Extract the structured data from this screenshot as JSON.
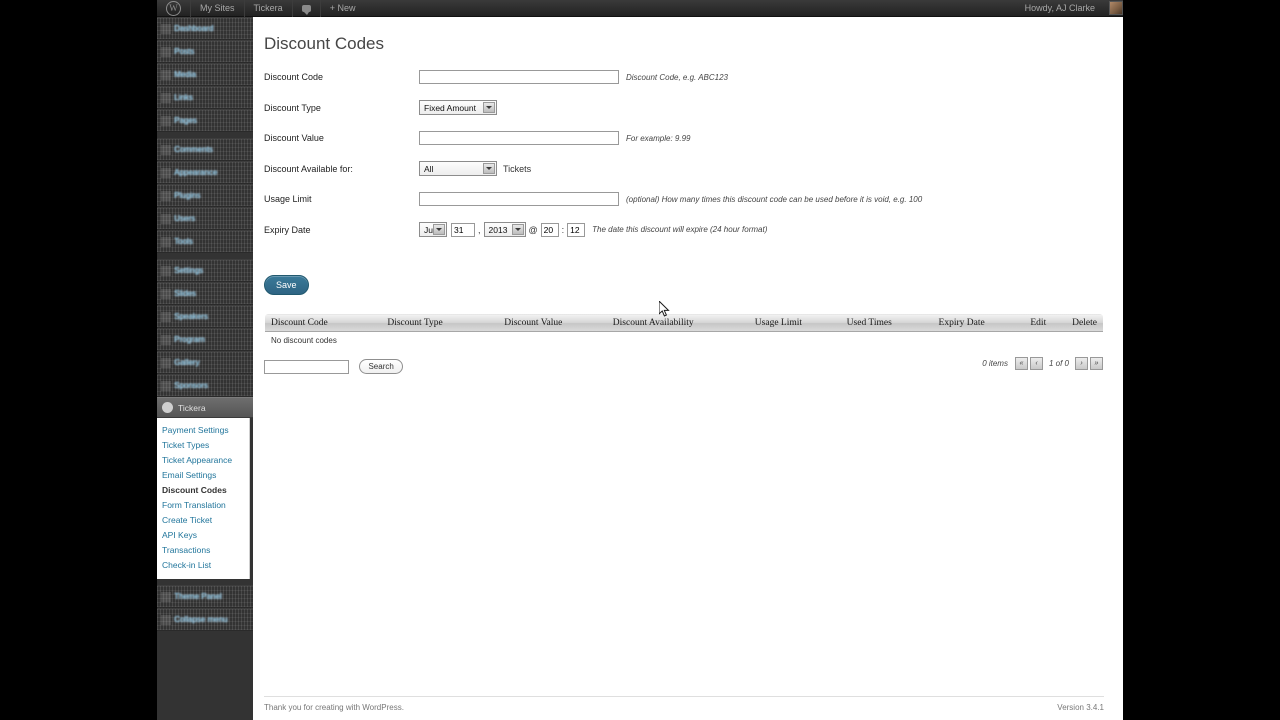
{
  "adminbar": {
    "logo_icon": "wordpress-logo-icon",
    "items": [
      "My Sites",
      "Tickera"
    ],
    "comments_icon": "comment-bubble-icon",
    "new_label": "+ New",
    "howdy": "Howdy, AJ Clarke",
    "avatar_icon": "user-avatar"
  },
  "sidebar": {
    "items": [
      {
        "label": "Dashboard",
        "icon": "dashboard-icon"
      },
      {
        "label": "Posts",
        "icon": "posts-icon"
      },
      {
        "label": "Media",
        "icon": "media-icon"
      },
      {
        "label": "Links",
        "icon": "links-icon"
      },
      {
        "label": "Pages",
        "icon": "pages-icon"
      },
      {
        "label": "Comments",
        "icon": "comments-icon"
      },
      {
        "label": "Appearance",
        "icon": "appearance-icon"
      },
      {
        "label": "Plugins",
        "icon": "plugins-icon"
      },
      {
        "label": "Users",
        "icon": "users-icon"
      },
      {
        "label": "Tools",
        "icon": "tools-icon"
      },
      {
        "label": "Settings",
        "icon": "settings-icon"
      },
      {
        "label": "Slides",
        "icon": "slides-icon"
      },
      {
        "label": "Speakers",
        "icon": "speakers-icon"
      },
      {
        "label": "Program",
        "icon": "program-icon"
      },
      {
        "label": "Gallery",
        "icon": "gallery-icon"
      },
      {
        "label": "Sponsors",
        "icon": "sponsors-icon"
      }
    ],
    "active_parent": {
      "label": "Tickera",
      "icon": "tickera-icon"
    },
    "submenu": [
      {
        "label": "Payment Settings",
        "active": false
      },
      {
        "label": "Ticket Types",
        "active": false
      },
      {
        "label": "Ticket Appearance",
        "active": false
      },
      {
        "label": "Email Settings",
        "active": false
      },
      {
        "label": "Discount Codes",
        "active": true
      },
      {
        "label": "Form Translation",
        "active": false
      },
      {
        "label": "Create Ticket",
        "active": false
      },
      {
        "label": "API Keys",
        "active": false
      },
      {
        "label": "Transactions",
        "active": false
      },
      {
        "label": "Check-in List",
        "active": false
      }
    ],
    "below_items": [
      {
        "label": "Theme Panel",
        "icon": "theme-panel-icon"
      },
      {
        "label": "Collapse menu",
        "icon": "collapse-icon"
      }
    ]
  },
  "page": {
    "title": "Discount Codes"
  },
  "form": {
    "rows": [
      {
        "label": "Discount Code",
        "value": "",
        "hint": "Discount Code, e.g. ABC123"
      },
      {
        "label": "Discount Type",
        "value": "Fixed Amount",
        "hint": ""
      },
      {
        "label": "Discount Value",
        "value": "",
        "hint": "For example: 9.99"
      },
      {
        "label": "Discount Available for:",
        "value": "All",
        "suffix": "Tickets",
        "hint": ""
      },
      {
        "label": "Usage Limit",
        "value": "",
        "hint": "(optional) How many times this discount code can be used before it is void, e.g. 100"
      },
      {
        "label": "Expiry Date",
        "hint": "The date this discount will expire (24 hour format)"
      }
    ],
    "expiry": {
      "month": "Jul",
      "day": "31",
      "year": "2013",
      "at": "@",
      "hour": "20",
      "colon": ":",
      "minute": "12"
    },
    "save_label": "Save"
  },
  "table": {
    "headers": [
      "Discount Code",
      "Discount Type",
      "Discount Value",
      "Discount Availability",
      "Usage Limit",
      "Used Times",
      "Expiry Date",
      "Edit",
      "Delete"
    ],
    "empty_message": "No discount codes"
  },
  "tablenav": {
    "search_value": "",
    "search_button": "Search",
    "items_count": "0 items",
    "first_icon": "«",
    "prev_icon": "‹",
    "page_label": "1 of 0",
    "next_icon": "›",
    "last_icon": "»"
  },
  "footer": {
    "credit": "Thank you for creating with WordPress.",
    "version": "Version 3.4.1"
  },
  "colors": {
    "admin_bar": "#2b2b2b",
    "sidebar": "#333333",
    "link": "#21759b",
    "save_button": "#2e6483",
    "content_bg": "#ffffff"
  }
}
